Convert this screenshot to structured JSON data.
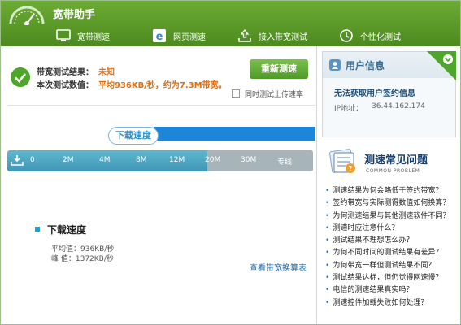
{
  "app": {
    "title": "宽带助手"
  },
  "tabs": [
    {
      "label": "宽带测速",
      "icon": "monitor-icon"
    },
    {
      "label": "网页测速",
      "icon": "ie-browser-icon"
    },
    {
      "label": "接入带宽测试",
      "icon": "network-upload-icon"
    },
    {
      "label": "个性化测试",
      "icon": "clock-icon"
    }
  ],
  "result": {
    "bandwidth_label": "带宽测试结果：",
    "bandwidth_value": "未知",
    "speed_label": "本次测试数值：",
    "speed_value": "平均936KB/秒，约为7.3M带宽。",
    "retest_button": "重新测速",
    "upload_checkbox_label": "同时测试上传速率"
  },
  "progress": {
    "bubble_label": "下载速度",
    "ticks": [
      "0",
      "2M",
      "4M",
      "8M",
      "12M",
      "20M",
      "30M",
      "专线"
    ]
  },
  "summary": {
    "title": "下载速度",
    "average": "平均值：936KB/秒",
    "peak": "峰  值：1372KB/秒",
    "table_link": "查看带宽换算表"
  },
  "user_info": {
    "title": "用户信息",
    "error": "无法获取用户签约信息",
    "ip_label": "IP地址：",
    "ip_value": "36.44.162.174"
  },
  "faq": {
    "title": "测速常见问题",
    "subtitle": "COMMON PROBLEM",
    "items": [
      "测速结果为何会略低于签约带宽？",
      "签约带宽与实际测得数值如何换算？",
      "为何测速结果与其他测速软件不同？",
      "测速时应注意什么？",
      "测试结果不理想怎么办？",
      "为何不同时间的测试结果有差异？",
      "为何带宽一样但测试结果不同？",
      "测试结果达标，但仍觉得网速慢？",
      "电信的测速结果真实吗？",
      "测速控件加载失败如何处理？"
    ]
  },
  "colors": {
    "header_green": "#5a9a28",
    "accent_orange": "#e46c0a",
    "progress_blue": "#1d86d8",
    "link_blue": "#1a6fb8"
  }
}
